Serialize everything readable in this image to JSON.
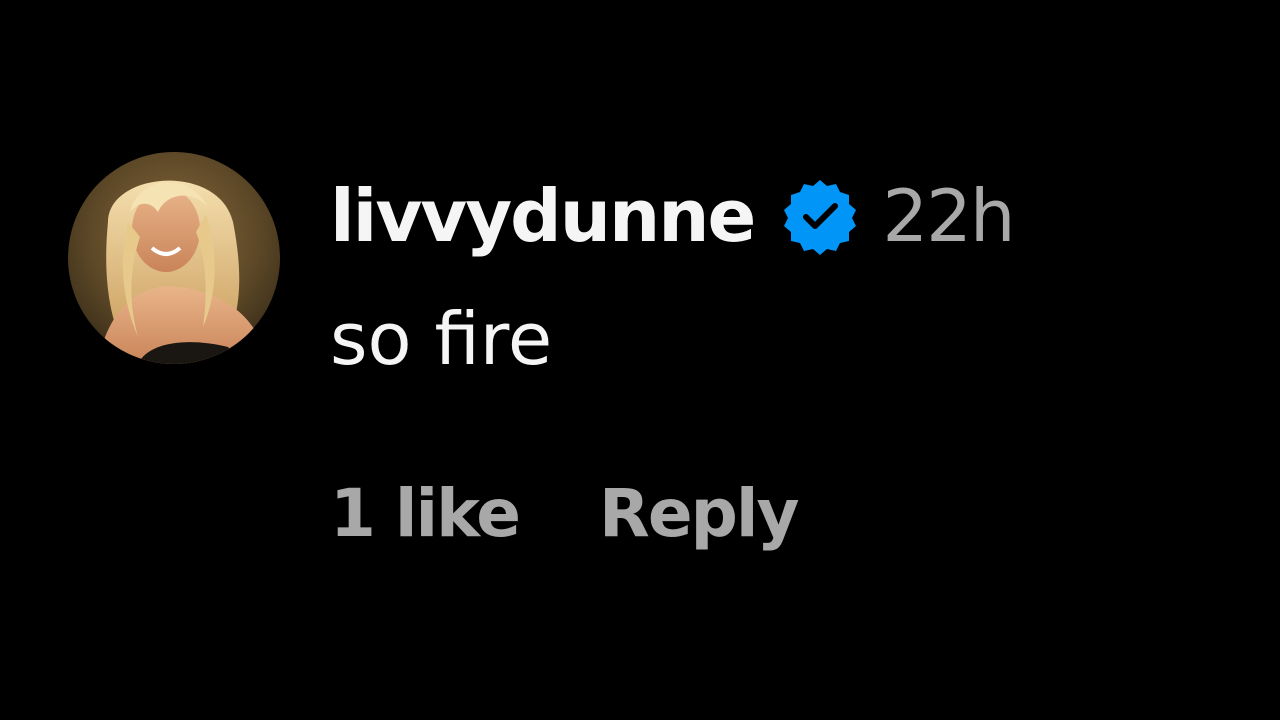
{
  "comment": {
    "username": "livvydunne",
    "verified_badge_icon": "verified-badge-icon",
    "verified_color": "#0095f6",
    "timestamp": "22h",
    "text": "so fire",
    "avatar_icon": "profile-photo",
    "actions": {
      "likes_label": "1 like",
      "reply_label": "Reply"
    }
  },
  "colors": {
    "background": "#000000",
    "primary_text": "#f5f5f5",
    "secondary_text": "#a8a8a8"
  }
}
